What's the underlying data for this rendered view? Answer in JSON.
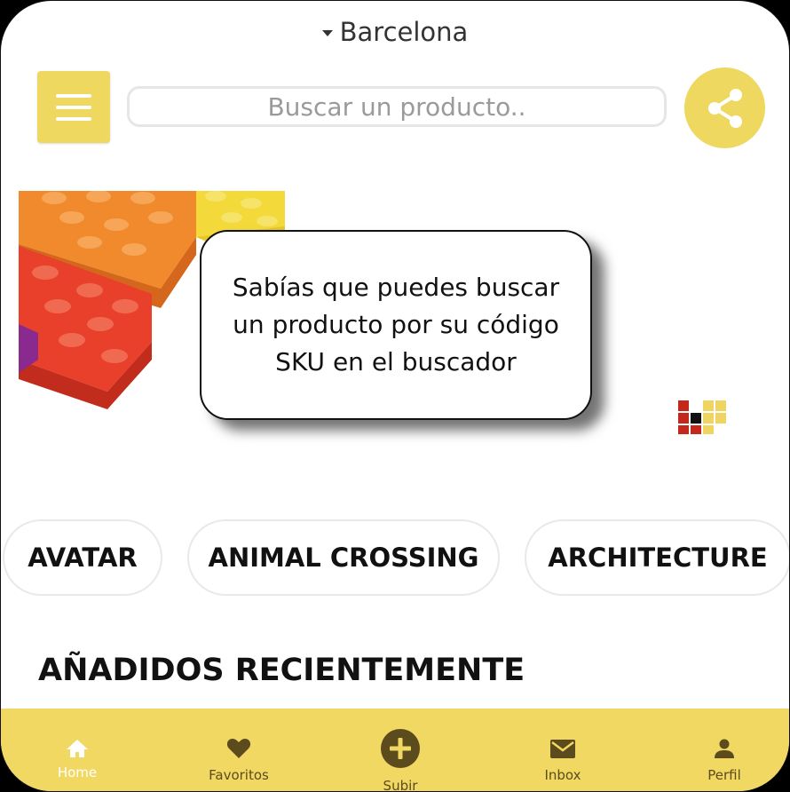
{
  "location": {
    "city": "Barcelona"
  },
  "search": {
    "placeholder": "Buscar un producto.."
  },
  "banner": {
    "text": "Sabías que puedes buscar un producto por su código SKU en el buscador"
  },
  "categories": [
    "AVATAR",
    "ANIMAL CROSSING",
    "ARCHITECTURE"
  ],
  "sections": {
    "recent_title": "AÑADIDOS RECIENTEMENTE"
  },
  "bottom_nav": [
    {
      "label": "Home",
      "icon": "home-icon",
      "active": true
    },
    {
      "label": "Favoritos",
      "icon": "heart-icon",
      "active": false
    },
    {
      "label": "Subir",
      "icon": "plus-icon",
      "active": false
    },
    {
      "label": "Inbox",
      "icon": "mail-icon",
      "active": false
    },
    {
      "label": "Perfil",
      "icon": "user-icon",
      "active": false
    }
  ],
  "colors": {
    "accent": "#efd860",
    "nav_bg": "#f0d862",
    "nav_icon": "#5c4b1c"
  }
}
